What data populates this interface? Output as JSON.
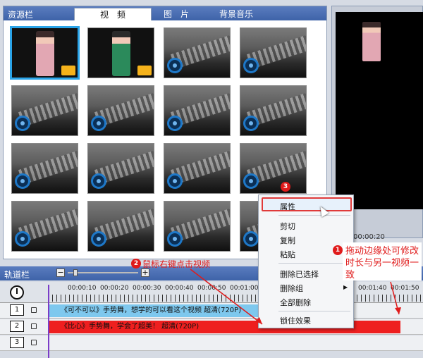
{
  "resource_panel": {
    "title": "资源栏",
    "tabs": [
      {
        "label": "视　频",
        "active": true
      },
      {
        "label": "图　片",
        "active": false
      },
      {
        "label": "背景音乐",
        "active": false
      }
    ],
    "thumbnails": [
      {
        "type": "video",
        "person": "pink",
        "selected": true
      },
      {
        "type": "video",
        "person": "green",
        "selected": false
      },
      {
        "type": "blank"
      },
      {
        "type": "blank"
      },
      {
        "type": "blank"
      },
      {
        "type": "blank"
      },
      {
        "type": "blank"
      },
      {
        "type": "blank"
      },
      {
        "type": "blank"
      },
      {
        "type": "blank"
      },
      {
        "type": "blank"
      },
      {
        "type": "blank"
      },
      {
        "type": "blank"
      },
      {
        "type": "blank"
      },
      {
        "type": "blank"
      },
      {
        "type": "blank"
      }
    ]
  },
  "preview": {
    "time": "00:00:20"
  },
  "track_panel": {
    "title": "轨道栏",
    "zoom_out": "−",
    "zoom_in": "+",
    "ruler": [
      "00:00:10",
      "00:00:20",
      "00:00:30",
      "00:00:40",
      "00:00:50",
      "00:01:00",
      "00:01:40",
      "00:01:50"
    ],
    "tracks": [
      {
        "num": "1",
        "clip": "《可不可以》手势舞，想学的可以看这个视频 超清(720P)"
      },
      {
        "num": "2",
        "clip": "《比心》手势舞，学会了超美！ 超清(720P)"
      },
      {
        "num": "3",
        "clip": ""
      }
    ]
  },
  "context_menu": {
    "items": [
      "属性",
      "剪切",
      "复制",
      "粘贴",
      "删除已选择",
      "删除组",
      "全部删除",
      "锁住效果"
    ]
  },
  "annotations": {
    "step1": {
      "num": "1",
      "text": "拖动边缘处可修改时长与另一视频一致"
    },
    "step2": {
      "num": "2",
      "text": "鼠标右键点击视频"
    },
    "step3": {
      "num": "3"
    }
  },
  "colors": {
    "accent": "#e01b1b",
    "header": "#4a6db3",
    "clip1": "#7ec8ee",
    "clip2": "#ee1f1f"
  }
}
